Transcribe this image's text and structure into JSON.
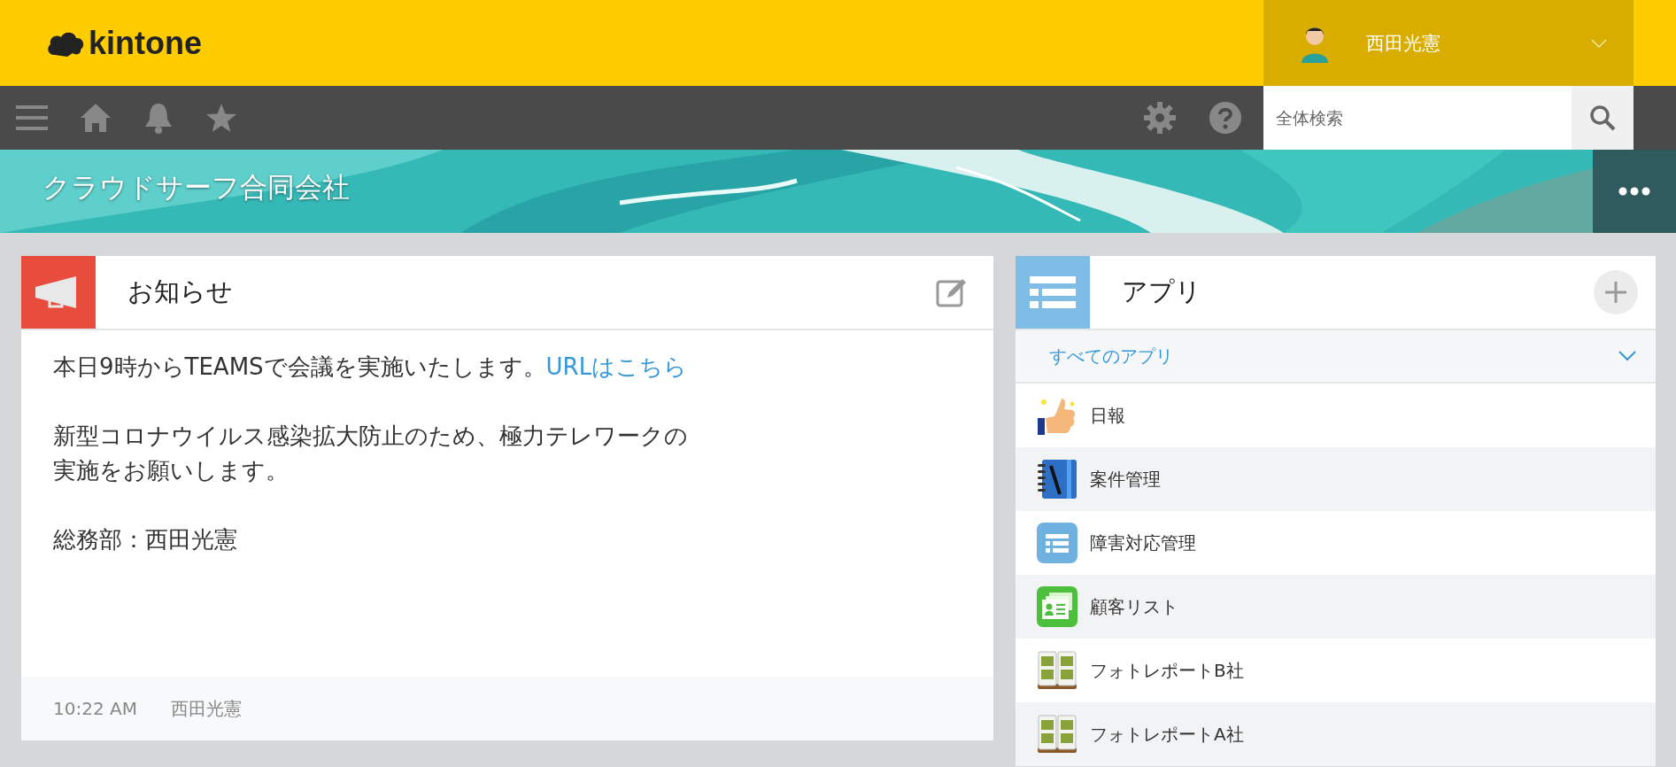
{
  "header": {
    "logo": "kintone",
    "user": {
      "name": "西田光憲"
    }
  },
  "toolbar": {
    "search": {
      "placeholder": "全体検索"
    }
  },
  "space": {
    "title": "クラウドサーフ合同会社"
  },
  "notice": {
    "title": "お知らせ",
    "paragraphs": [
      {
        "text": "本日9時からTEAMSで会議を実施いたします。",
        "link": "URLはこちら"
      },
      {
        "text": "新型コロナウイルス感染拡大防止のため、極力テレワークの実施をお願いします。"
      },
      {
        "text": "総務部：西田光憲"
      }
    ],
    "footer": {
      "time": "10:22 AM",
      "author": "西田光憲"
    }
  },
  "apps": {
    "title": "アプリ",
    "filter": "すべてのアプリ",
    "items": [
      {
        "name": "日報",
        "kind": "thumbs"
      },
      {
        "name": "案件管理",
        "kind": "notebook"
      },
      {
        "name": "障害対応管理",
        "kind": "list"
      },
      {
        "name": "顧客リスト",
        "kind": "cards"
      },
      {
        "name": "フォトレポートB社",
        "kind": "album"
      },
      {
        "name": "フォトレポートA社",
        "kind": "album"
      }
    ]
  }
}
